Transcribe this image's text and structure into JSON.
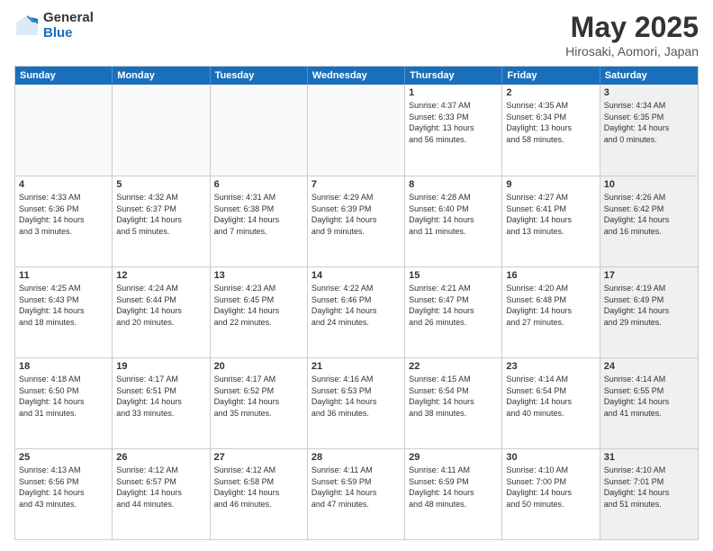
{
  "logo": {
    "general": "General",
    "blue": "Blue"
  },
  "title": {
    "month": "May 2025",
    "location": "Hirosaki, Aomori, Japan"
  },
  "weekdays": [
    "Sunday",
    "Monday",
    "Tuesday",
    "Wednesday",
    "Thursday",
    "Friday",
    "Saturday"
  ],
  "rows": [
    [
      {
        "day": "",
        "empty": true,
        "text": ""
      },
      {
        "day": "",
        "empty": true,
        "text": ""
      },
      {
        "day": "",
        "empty": true,
        "text": ""
      },
      {
        "day": "",
        "empty": true,
        "text": ""
      },
      {
        "day": "1",
        "text": "Sunrise: 4:37 AM\nSunset: 6:33 PM\nDaylight: 13 hours\nand 56 minutes."
      },
      {
        "day": "2",
        "text": "Sunrise: 4:35 AM\nSunset: 6:34 PM\nDaylight: 13 hours\nand 58 minutes."
      },
      {
        "day": "3",
        "shaded": true,
        "text": "Sunrise: 4:34 AM\nSunset: 6:35 PM\nDaylight: 14 hours\nand 0 minutes."
      }
    ],
    [
      {
        "day": "4",
        "text": "Sunrise: 4:33 AM\nSunset: 6:36 PM\nDaylight: 14 hours\nand 3 minutes."
      },
      {
        "day": "5",
        "text": "Sunrise: 4:32 AM\nSunset: 6:37 PM\nDaylight: 14 hours\nand 5 minutes."
      },
      {
        "day": "6",
        "text": "Sunrise: 4:31 AM\nSunset: 6:38 PM\nDaylight: 14 hours\nand 7 minutes."
      },
      {
        "day": "7",
        "text": "Sunrise: 4:29 AM\nSunset: 6:39 PM\nDaylight: 14 hours\nand 9 minutes."
      },
      {
        "day": "8",
        "text": "Sunrise: 4:28 AM\nSunset: 6:40 PM\nDaylight: 14 hours\nand 11 minutes."
      },
      {
        "day": "9",
        "text": "Sunrise: 4:27 AM\nSunset: 6:41 PM\nDaylight: 14 hours\nand 13 minutes."
      },
      {
        "day": "10",
        "shaded": true,
        "text": "Sunrise: 4:26 AM\nSunset: 6:42 PM\nDaylight: 14 hours\nand 16 minutes."
      }
    ],
    [
      {
        "day": "11",
        "text": "Sunrise: 4:25 AM\nSunset: 6:43 PM\nDaylight: 14 hours\nand 18 minutes."
      },
      {
        "day": "12",
        "text": "Sunrise: 4:24 AM\nSunset: 6:44 PM\nDaylight: 14 hours\nand 20 minutes."
      },
      {
        "day": "13",
        "text": "Sunrise: 4:23 AM\nSunset: 6:45 PM\nDaylight: 14 hours\nand 22 minutes."
      },
      {
        "day": "14",
        "text": "Sunrise: 4:22 AM\nSunset: 6:46 PM\nDaylight: 14 hours\nand 24 minutes."
      },
      {
        "day": "15",
        "text": "Sunrise: 4:21 AM\nSunset: 6:47 PM\nDaylight: 14 hours\nand 26 minutes."
      },
      {
        "day": "16",
        "text": "Sunrise: 4:20 AM\nSunset: 6:48 PM\nDaylight: 14 hours\nand 27 minutes."
      },
      {
        "day": "17",
        "shaded": true,
        "text": "Sunrise: 4:19 AM\nSunset: 6:49 PM\nDaylight: 14 hours\nand 29 minutes."
      }
    ],
    [
      {
        "day": "18",
        "text": "Sunrise: 4:18 AM\nSunset: 6:50 PM\nDaylight: 14 hours\nand 31 minutes."
      },
      {
        "day": "19",
        "text": "Sunrise: 4:17 AM\nSunset: 6:51 PM\nDaylight: 14 hours\nand 33 minutes."
      },
      {
        "day": "20",
        "text": "Sunrise: 4:17 AM\nSunset: 6:52 PM\nDaylight: 14 hours\nand 35 minutes."
      },
      {
        "day": "21",
        "text": "Sunrise: 4:16 AM\nSunset: 6:53 PM\nDaylight: 14 hours\nand 36 minutes."
      },
      {
        "day": "22",
        "text": "Sunrise: 4:15 AM\nSunset: 6:54 PM\nDaylight: 14 hours\nand 38 minutes."
      },
      {
        "day": "23",
        "text": "Sunrise: 4:14 AM\nSunset: 6:54 PM\nDaylight: 14 hours\nand 40 minutes."
      },
      {
        "day": "24",
        "shaded": true,
        "text": "Sunrise: 4:14 AM\nSunset: 6:55 PM\nDaylight: 14 hours\nand 41 minutes."
      }
    ],
    [
      {
        "day": "25",
        "text": "Sunrise: 4:13 AM\nSunset: 6:56 PM\nDaylight: 14 hours\nand 43 minutes."
      },
      {
        "day": "26",
        "text": "Sunrise: 4:12 AM\nSunset: 6:57 PM\nDaylight: 14 hours\nand 44 minutes."
      },
      {
        "day": "27",
        "text": "Sunrise: 4:12 AM\nSunset: 6:58 PM\nDaylight: 14 hours\nand 46 minutes."
      },
      {
        "day": "28",
        "text": "Sunrise: 4:11 AM\nSunset: 6:59 PM\nDaylight: 14 hours\nand 47 minutes."
      },
      {
        "day": "29",
        "text": "Sunrise: 4:11 AM\nSunset: 6:59 PM\nDaylight: 14 hours\nand 48 minutes."
      },
      {
        "day": "30",
        "text": "Sunrise: 4:10 AM\nSunset: 7:00 PM\nDaylight: 14 hours\nand 50 minutes."
      },
      {
        "day": "31",
        "shaded": true,
        "text": "Sunrise: 4:10 AM\nSunset: 7:01 PM\nDaylight: 14 hours\nand 51 minutes."
      }
    ]
  ]
}
